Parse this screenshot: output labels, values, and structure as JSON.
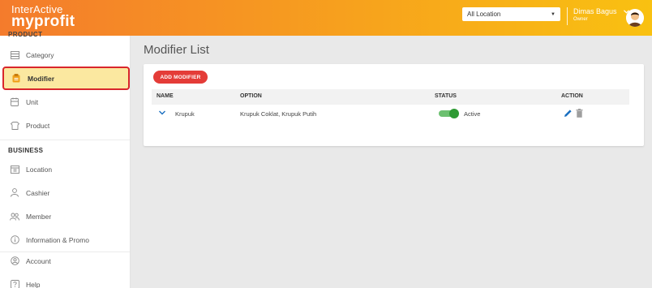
{
  "header": {
    "logo_line1": "InterActive",
    "logo_line2": "myprofit",
    "location_select": "All Location",
    "user_name": "Dimas Bagus",
    "user_role": "Owner"
  },
  "sidebar": {
    "cut_section": "PRODUCT",
    "product_items": [
      {
        "label": "Category",
        "icon": "category-icon"
      },
      {
        "label": "Modifier",
        "icon": "modifier-icon",
        "active": true
      },
      {
        "label": "Unit",
        "icon": "unit-icon"
      },
      {
        "label": "Product",
        "icon": "product-icon"
      }
    ],
    "business_header": "BUSINESS",
    "business_items": [
      {
        "label": "Location",
        "icon": "location-icon"
      },
      {
        "label": "Cashier",
        "icon": "cashier-icon"
      },
      {
        "label": "Member",
        "icon": "member-icon"
      },
      {
        "label": "Information & Promo",
        "icon": "info-icon"
      }
    ],
    "bottom_items": [
      {
        "label": "Account",
        "icon": "account-icon"
      },
      {
        "label": "Help",
        "icon": "help-icon"
      }
    ]
  },
  "main": {
    "title": "Modifier List",
    "add_button": "ADD MODIFIER",
    "columns": [
      "NAME",
      "OPTION",
      "STATUS",
      "ACTION"
    ],
    "rows": [
      {
        "name": "Krupuk",
        "option": "Krupuk Coklat, Krupuk Putih",
        "status": "Active"
      }
    ]
  },
  "colors": {
    "header_start": "#f47b2c",
    "header_end": "#f9c111",
    "accent_red": "#e43c38",
    "active_bg": "#fbe8a0",
    "toggle_on": "#2e9a34",
    "action_blue": "#1a6fc0"
  }
}
